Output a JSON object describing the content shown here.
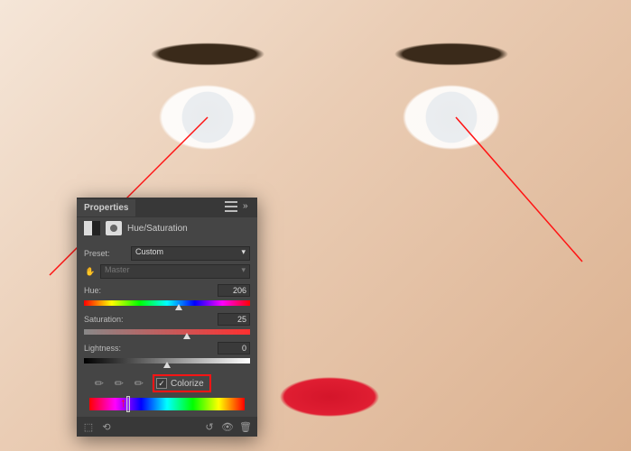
{
  "panel": {
    "title": "Properties",
    "adjustment_name": "Hue/Saturation",
    "preset_label": "Preset:",
    "preset_value": "Custom",
    "channel_value": "Master",
    "sliders": {
      "hue": {
        "label": "Hue:",
        "value": "206",
        "percent": 57
      },
      "saturation": {
        "label": "Saturation:",
        "value": "25",
        "percent": 62
      },
      "lightness": {
        "label": "Lightness:",
        "value": "0",
        "percent": 50
      }
    },
    "colorize_label": "Colorize",
    "colorize_checked": "✓",
    "icons": {
      "adjustment": "adjustment-icon",
      "mask": "mask-icon",
      "hand": "✋",
      "eyedropper": "✎",
      "clip": "⬚",
      "previous": "⟲",
      "reset": "↺",
      "visibility": "👁",
      "trash": "🗑"
    }
  }
}
